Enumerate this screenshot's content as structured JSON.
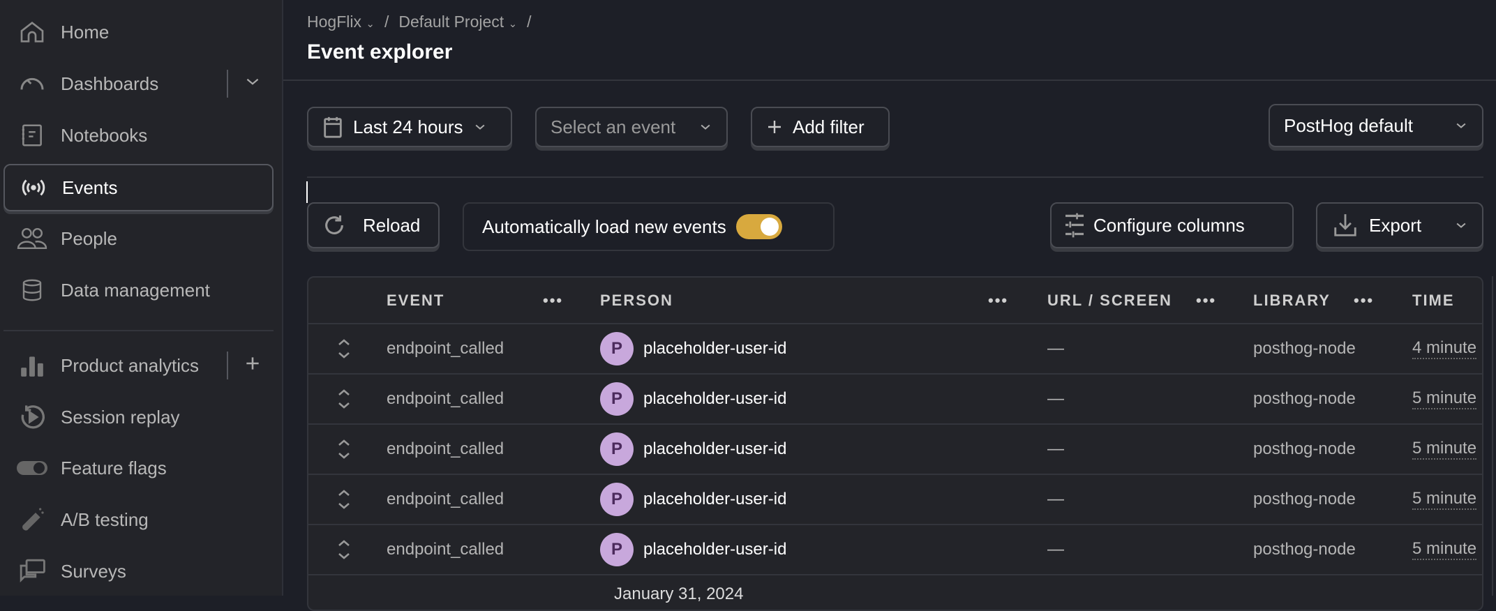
{
  "sidebar": {
    "items": [
      {
        "label": "Home",
        "icon": "home-icon"
      },
      {
        "label": "Dashboards",
        "icon": "gauge-icon"
      },
      {
        "label": "Notebooks",
        "icon": "notebook-icon"
      },
      {
        "label": "Events",
        "icon": "broadcast-icon",
        "active": true
      },
      {
        "label": "People",
        "icon": "people-icon"
      },
      {
        "label": "Data management",
        "icon": "database-icon"
      },
      {
        "label": "Product analytics",
        "icon": "bar-chart-icon"
      },
      {
        "label": "Session replay",
        "icon": "replay-icon"
      },
      {
        "label": "Feature flags",
        "icon": "toggle-icon"
      },
      {
        "label": "A/B testing",
        "icon": "flask-icon"
      },
      {
        "label": "Surveys",
        "icon": "chat-icon"
      }
    ]
  },
  "header": {
    "breadcrumbs": [
      "HogFlix",
      "Default Project"
    ],
    "separator": "/",
    "title": "Event explorer"
  },
  "filters": {
    "date_range": "Last 24 hours",
    "event_placeholder": "Select an event",
    "add_filter": "Add filter",
    "preset": "PostHog default"
  },
  "actions": {
    "reload": "Reload",
    "auto_load": "Automatically load new events",
    "auto_load_enabled": true,
    "configure_columns": "Configure columns",
    "export": "Export",
    "accent": "#d8a93e"
  },
  "table": {
    "columns": [
      "EVENT",
      "PERSON",
      "URL / SCREEN",
      "LIBRARY",
      "TIME"
    ],
    "rows": [
      {
        "event": "endpoint_called",
        "avatar": "P",
        "person": "placeholder-user-id",
        "url": "—",
        "library": "posthog-node",
        "time": "4 minute"
      },
      {
        "event": "endpoint_called",
        "avatar": "P",
        "person": "placeholder-user-id",
        "url": "—",
        "library": "posthog-node",
        "time": "5 minute"
      },
      {
        "event": "endpoint_called",
        "avatar": "P",
        "person": "placeholder-user-id",
        "url": "—",
        "library": "posthog-node",
        "time": "5 minute"
      },
      {
        "event": "endpoint_called",
        "avatar": "P",
        "person": "placeholder-user-id",
        "url": "—",
        "library": "posthog-node",
        "time": "5 minute"
      },
      {
        "event": "endpoint_called",
        "avatar": "P",
        "person": "placeholder-user-id",
        "url": "—",
        "library": "posthog-node",
        "time": "5 minute"
      }
    ],
    "date_divider": "January 31, 2024"
  }
}
